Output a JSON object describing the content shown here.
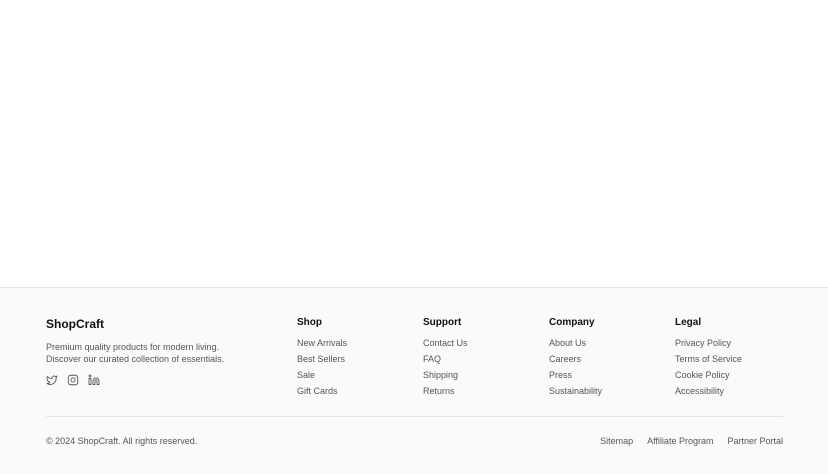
{
  "brand": {
    "name": "ShopCraft",
    "description_line1": "Premium quality products for modern living.",
    "description_line2": "Discover our curated collection of essentials."
  },
  "socials": [
    {
      "icon": "twitter-icon"
    },
    {
      "icon": "instagram-icon"
    },
    {
      "icon": "linkedin-icon"
    }
  ],
  "columns": {
    "shop": {
      "title": "Shop",
      "links": [
        "New Arrivals",
        "Best Sellers",
        "Sale",
        "Gift Cards"
      ]
    },
    "support": {
      "title": "Support",
      "links": [
        "Contact Us",
        "FAQ",
        "Shipping",
        "Returns"
      ]
    },
    "company": {
      "title": "Company",
      "links": [
        "About Us",
        "Careers",
        "Press",
        "Sustainability"
      ]
    },
    "legal": {
      "title": "Legal",
      "links": [
        "Privacy Policy",
        "Terms of Service",
        "Cookie Policy",
        "Accessibility"
      ]
    }
  },
  "bottom": {
    "copyright": "© 2024 ShopCraft. All rights reserved.",
    "links": [
      "Sitemap",
      "Affiliate Program",
      "Partner Portal"
    ]
  },
  "colors": {
    "footer_background": "#fafafa",
    "text_primary": "#111111",
    "text_secondary": "#555555",
    "divider": "#e5e5e5"
  }
}
